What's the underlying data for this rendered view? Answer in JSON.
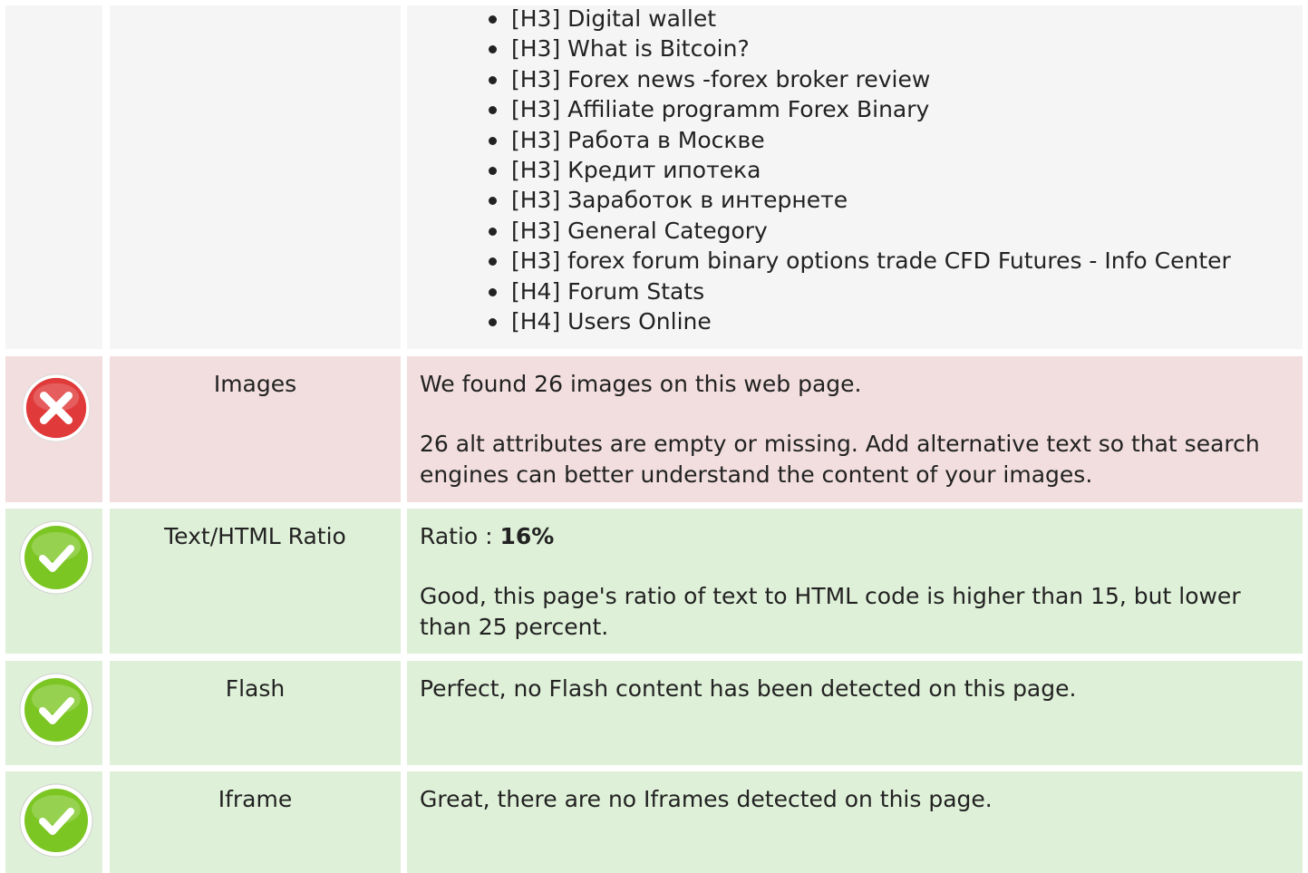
{
  "headings_row": {
    "items": [
      "[H3] Digital wallet",
      "[H3] What is Bitcoin?",
      "[H3] Forex news -forex broker review",
      "[H3] Affiliate programm Forex Binary",
      "[H3] Работа в Москве",
      "[H3] Кредит ипотека",
      "[H3] Заработок в интернете",
      "[H3] General Category",
      "[H3] forex forum binary options trade CFD Futures - Info Center",
      "[H4] Forum Stats",
      "[H4] Users Online"
    ]
  },
  "images_row": {
    "status": "error",
    "label": "Images",
    "line1": "We found 26 images on this web page.",
    "line2": "26 alt attributes are empty or missing. Add alternative text so that search engines can better understand the content of your images."
  },
  "ratio_row": {
    "status": "ok",
    "label": "Text/HTML Ratio",
    "ratio_prefix": "Ratio : ",
    "ratio_value": "16%",
    "line2": "Good, this page's ratio of text to HTML code is higher than 15, but lower than 25 percent."
  },
  "flash_row": {
    "status": "ok",
    "label": "Flash",
    "line1": "Perfect, no Flash content has been detected on this page."
  },
  "iframe_row": {
    "status": "ok",
    "label": "Iframe",
    "line1": "Great, there are no Iframes detected on this page."
  },
  "colors": {
    "error_bg": "#f2dede",
    "ok_bg": "#dff0d8",
    "neutral_bg": "#f5f5f5",
    "error_icon": "#e03a3a",
    "ok_icon": "#7cc623"
  },
  "icons": {
    "error": "error-x-circle-icon",
    "ok": "check-circle-icon"
  }
}
